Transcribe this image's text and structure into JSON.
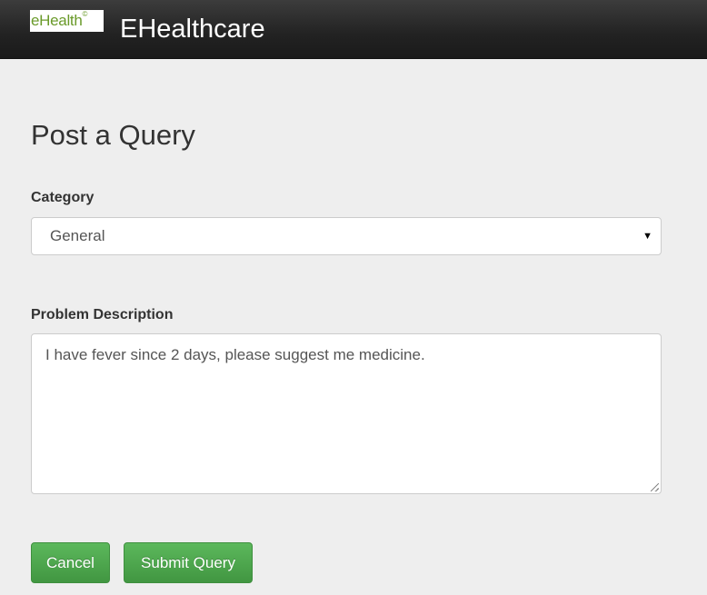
{
  "navbar": {
    "logo_text": "eHealth",
    "logo_mark": "©",
    "brand": "EHealthcare"
  },
  "form": {
    "title": "Post a Query",
    "category_label": "Category",
    "category_value": "General",
    "description_label": "Problem Description",
    "description_value": "I have fever since 2 days, please suggest me medicine."
  },
  "buttons": {
    "cancel": "Cancel",
    "submit": "Submit Query"
  },
  "colors": {
    "navbar": "#222222",
    "button_green": "#5cb85c",
    "background": "#eeeeee"
  }
}
